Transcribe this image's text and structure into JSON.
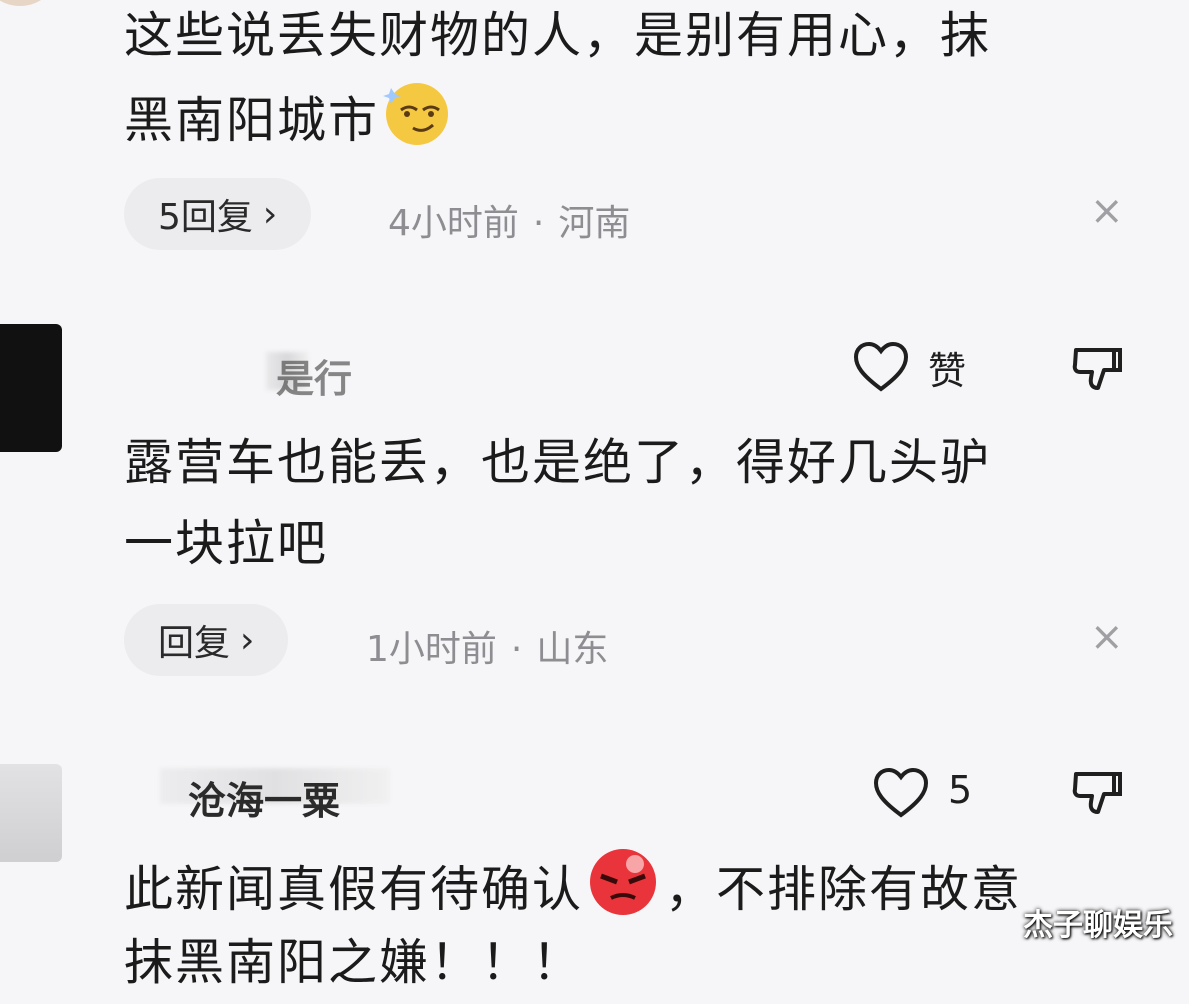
{
  "comments": [
    {
      "text_lines": [
        "这些说丢失财物的人，是别有用心，抹",
        "黑南阳城市"
      ],
      "emoji": "smug-face-emoji",
      "reply_label": "5回复",
      "time": "4小时前",
      "location": "河南"
    },
    {
      "username": "是行",
      "like_label": "赞",
      "text_lines": [
        "露营车也能丢，也是绝了，得好几头驴",
        "一块拉吧"
      ],
      "reply_label": "回复",
      "time": "1小时前",
      "location": "山东"
    },
    {
      "username": "沧海一粟",
      "like_count": "5",
      "text_lines": [
        "此新闻真假有待确认",
        "，不排除有故意",
        "抹黑南阳之嫌！！！"
      ],
      "emoji": "angry-face-emoji"
    }
  ],
  "meta_separator": "·",
  "chevron": "›",
  "close_glyph": "×",
  "watermark": "杰子聊娱乐",
  "colors": {
    "background": "#f6f6f8",
    "pill": "#ececef",
    "meta": "#8d8d92"
  }
}
